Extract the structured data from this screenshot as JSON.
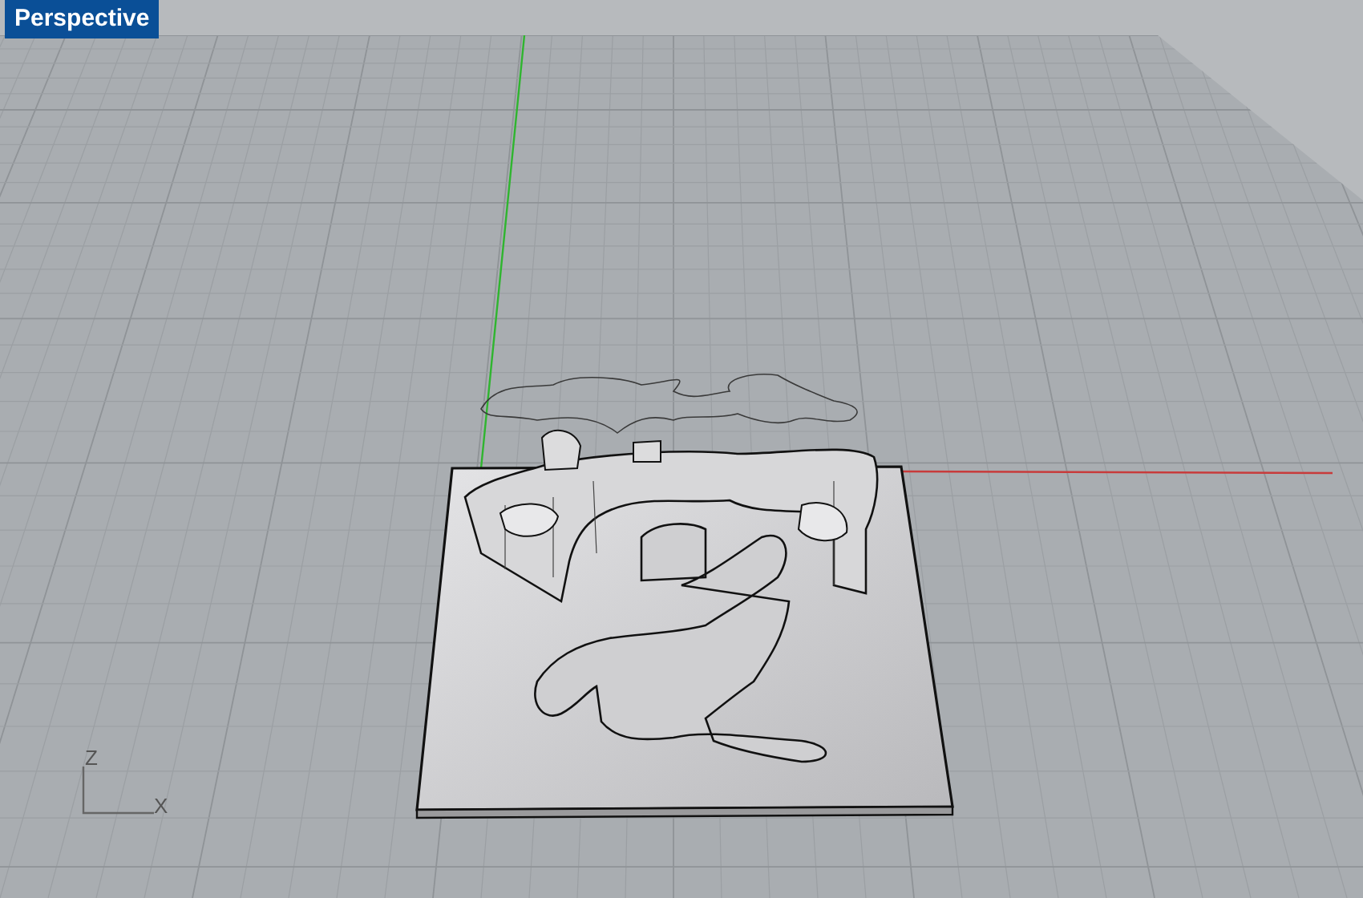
{
  "viewport": {
    "title": "Perspective",
    "axes": [
      {
        "label": "Z"
      },
      {
        "label": "X"
      }
    ]
  }
}
